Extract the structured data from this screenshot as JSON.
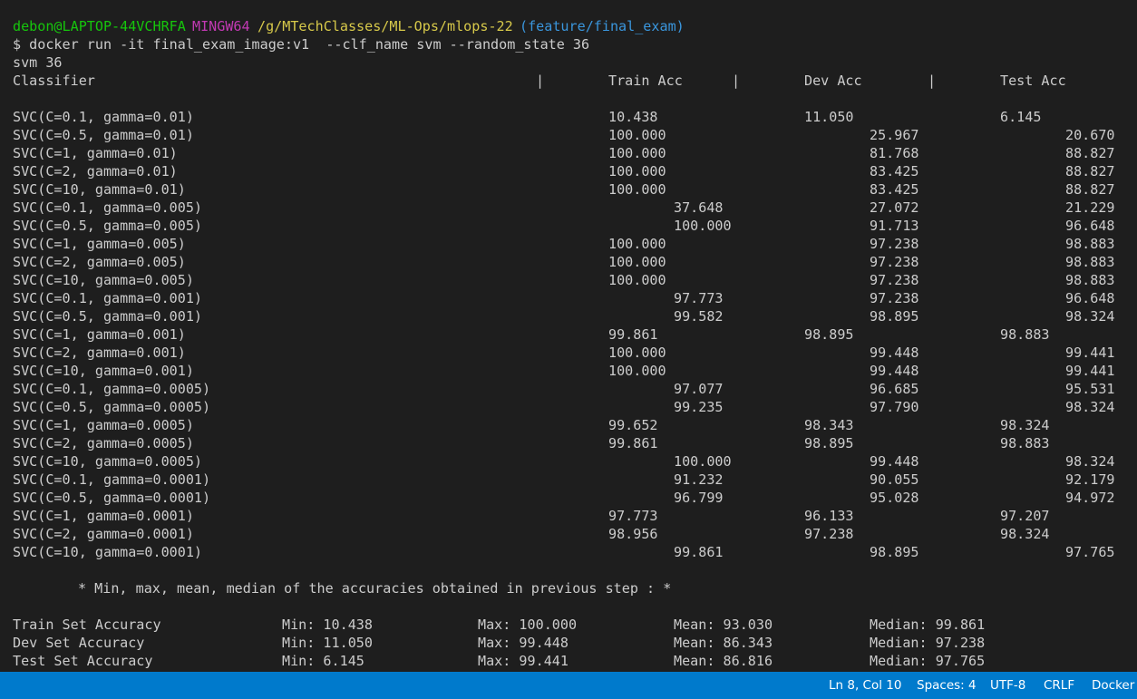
{
  "prompt": {
    "user": "debon@LAPTOP-44VCHRFA",
    "env": "MINGW64",
    "path": "/g/MTechClasses/ML-Ops/mlops-22",
    "branch": "(feature/final_exam)"
  },
  "command": "$ docker run -it final_exam_image:v1  --clf_name svm --random_state 36",
  "output_args": "svm 36",
  "table": {
    "headers": [
      "Classifier",
      "Train Acc",
      "Dev Acc",
      "Test Acc"
    ],
    "separator": "|",
    "rows": [
      {
        "name": "SVC(C=0.1, gamma=0.01)",
        "train": "10.438",
        "dev": "11.050",
        "test": "6.145"
      },
      {
        "name": "SVC(C=0.5, gamma=0.01)",
        "train": "100.000",
        "dev": "25.967",
        "test": "20.670"
      },
      {
        "name": "SVC(C=1, gamma=0.01)",
        "train": "100.000",
        "dev": "81.768",
        "test": "88.827"
      },
      {
        "name": "SVC(C=2, gamma=0.01)",
        "train": "100.000",
        "dev": "83.425",
        "test": "88.827"
      },
      {
        "name": "SVC(C=10, gamma=0.01)",
        "train": "100.000",
        "dev": "83.425",
        "test": "88.827"
      },
      {
        "name": "SVC(C=0.1, gamma=0.005)",
        "train": "37.648",
        "dev": "27.072",
        "test": "21.229"
      },
      {
        "name": "SVC(C=0.5, gamma=0.005)",
        "train": "100.000",
        "dev": "91.713",
        "test": "96.648"
      },
      {
        "name": "SVC(C=1, gamma=0.005)",
        "train": "100.000",
        "dev": "97.238",
        "test": "98.883"
      },
      {
        "name": "SVC(C=2, gamma=0.005)",
        "train": "100.000",
        "dev": "97.238",
        "test": "98.883"
      },
      {
        "name": "SVC(C=10, gamma=0.005)",
        "train": "100.000",
        "dev": "97.238",
        "test": "98.883"
      },
      {
        "name": "SVC(C=0.1, gamma=0.001)",
        "train": "97.773",
        "dev": "97.238",
        "test": "96.648"
      },
      {
        "name": "SVC(C=0.5, gamma=0.001)",
        "train": "99.582",
        "dev": "98.895",
        "test": "98.324"
      },
      {
        "name": "SVC(C=1, gamma=0.001)",
        "train": "99.861",
        "dev": "98.895",
        "test": "98.883"
      },
      {
        "name": "SVC(C=2, gamma=0.001)",
        "train": "100.000",
        "dev": "99.448",
        "test": "99.441"
      },
      {
        "name": "SVC(C=10, gamma=0.001)",
        "train": "100.000",
        "dev": "99.448",
        "test": "99.441"
      },
      {
        "name": "SVC(C=0.1, gamma=0.0005)",
        "train": "97.077",
        "dev": "96.685",
        "test": "95.531"
      },
      {
        "name": "SVC(C=0.5, gamma=0.0005)",
        "train": "99.235",
        "dev": "97.790",
        "test": "98.324"
      },
      {
        "name": "SVC(C=1, gamma=0.0005)",
        "train": "99.652",
        "dev": "98.343",
        "test": "98.324"
      },
      {
        "name": "SVC(C=2, gamma=0.0005)",
        "train": "99.861",
        "dev": "98.895",
        "test": "98.883"
      },
      {
        "name": "SVC(C=10, gamma=0.0005)",
        "train": "100.000",
        "dev": "99.448",
        "test": "98.324"
      },
      {
        "name": "SVC(C=0.1, gamma=0.0001)",
        "train": "91.232",
        "dev": "90.055",
        "test": "92.179"
      },
      {
        "name": "SVC(C=0.5, gamma=0.0001)",
        "train": "96.799",
        "dev": "95.028",
        "test": "94.972"
      },
      {
        "name": "SVC(C=1, gamma=0.0001)",
        "train": "97.773",
        "dev": "96.133",
        "test": "97.207"
      },
      {
        "name": "SVC(C=2, gamma=0.0001)",
        "train": "98.956",
        "dev": "97.238",
        "test": "98.324"
      },
      {
        "name": "SVC(C=10, gamma=0.0001)",
        "train": "99.861",
        "dev": "98.895",
        "test": "97.765"
      }
    ]
  },
  "summary_heading": "* Min, max, mean, median of the accuracies obtained in previous step : *",
  "summary": [
    {
      "label": "Train Set Accuracy",
      "min": "Min: 10.438",
      "max": "Max: 100.000",
      "mean": "Mean: 93.030",
      "median": "Median: 99.861"
    },
    {
      "label": "Dev Set Accuracy",
      "min": "Min: 11.050",
      "max": "Max: 99.448",
      "mean": "Mean: 86.343",
      "median": "Median: 97.238"
    },
    {
      "label": "Test Set Accuracy",
      "min": "Min: 6.145",
      "max": "Max: 99.441",
      "mean": "Mean: 86.816",
      "median": "Median: 97.765"
    }
  ],
  "statusbar": {
    "position": "Ln 8, Col 10",
    "spaces": "Spaces: 4",
    "encoding": "UTF-8",
    "eol": "CRLF",
    "language": "Docker"
  },
  "colors": {
    "background": "#1e1e1e",
    "text": "#cccccc",
    "user": "#16c60c",
    "mingw": "#c239b3",
    "path": "#d7c94a",
    "branch": "#3a96dd",
    "statusbar": "#007acc"
  }
}
